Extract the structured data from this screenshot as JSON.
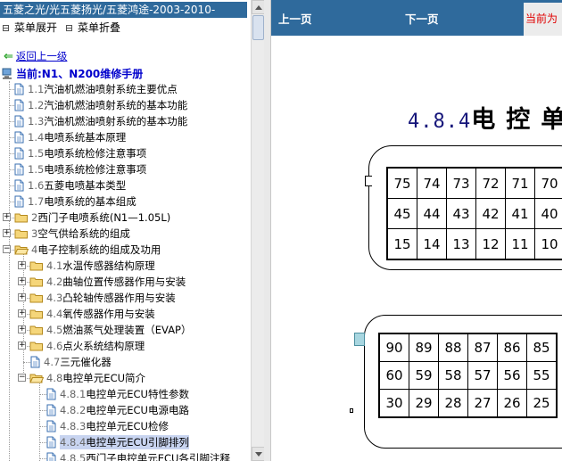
{
  "window": {
    "title": "五菱之光/光五菱扬光/五菱鸿途-2003-2010-"
  },
  "menu": {
    "expand_label": "菜单展开",
    "collapse_label": "菜单折叠"
  },
  "nav": {
    "back_label": "返回上一级",
    "current_label": "当前:N1、N200维修手册"
  },
  "tree": [
    {
      "num": "1.1",
      "label": "汽油机燃油喷射系统主要优点",
      "type": "doc"
    },
    {
      "num": "1.2",
      "label": "汽油机燃油喷射系统的基本功能",
      "type": "doc"
    },
    {
      "num": "1.3",
      "label": "汽油机燃油喷射系统的基本功能",
      "type": "doc"
    },
    {
      "num": "1.4",
      "label": "电喷系统基本原理",
      "type": "doc"
    },
    {
      "num": "1.5",
      "label": "电喷系统检修注意事项",
      "type": "doc"
    },
    {
      "num": "1.5",
      "label": "电喷系统检修注意事项",
      "type": "doc"
    },
    {
      "num": "1.6",
      "label": "五菱电喷基本类型",
      "type": "doc"
    },
    {
      "num": "1.7",
      "label": "电喷系统的基本组成",
      "type": "doc"
    },
    {
      "num": "2",
      "label": "西门子电喷系统(N1—1.05L)",
      "type": "folder"
    },
    {
      "num": "3",
      "label": "空气供给系统的组成",
      "type": "folder"
    },
    {
      "num": "4",
      "label": "电子控制系统的组成及功用",
      "type": "folder-open"
    },
    {
      "num": "4.1",
      "label": "水温传感器结构原理",
      "type": "subfolder"
    },
    {
      "num": "4.2",
      "label": "曲轴位置传感器作用与安装",
      "type": "subfolder"
    },
    {
      "num": "4.3",
      "label": "凸轮轴传感器作用与安装",
      "type": "subfolder"
    },
    {
      "num": "4.4",
      "label": "氧传感器作用与安装",
      "type": "subfolder"
    },
    {
      "num": "4.5",
      "label": "燃油蒸气处理装置（EVAP）",
      "type": "subfolder"
    },
    {
      "num": "4.6",
      "label": "点火系统结构原理",
      "type": "subfolder"
    },
    {
      "num": "4.7",
      "label": "三元催化器",
      "type": "subdoc"
    },
    {
      "num": "4.8",
      "label": "电控单元ECU简介",
      "type": "subfolder-open"
    },
    {
      "num": "4.8.1",
      "label": "电控单元ECU特性参数",
      "type": "leaf"
    },
    {
      "num": "4.8.2",
      "label": "电控单元ECU电源电路",
      "type": "leaf"
    },
    {
      "num": "4.8.3",
      "label": "电控单元ECU检修",
      "type": "leaf"
    },
    {
      "num": "4.8.4",
      "label": "电控单元ECU引脚排列",
      "type": "leaf",
      "selected": true
    },
    {
      "num": "4.8.5",
      "label": "西门子电控单元ECU各引脚注释",
      "type": "leaf"
    }
  ],
  "toolbar": {
    "prev_label": "上一页",
    "next_label": "下一页",
    "current_label": "当前为"
  },
  "content": {
    "heading_num": "4.8.4",
    "heading_text": "电控单",
    "connector1": [
      [
        "75",
        "74",
        "73",
        "72",
        "71",
        "70"
      ],
      [
        "45",
        "44",
        "43",
        "42",
        "41",
        "40"
      ],
      [
        "15",
        "14",
        "13",
        "12",
        "11",
        "10"
      ]
    ],
    "connector2": [
      [
        "90",
        "89",
        "88",
        "87",
        "86",
        "85"
      ],
      [
        "60",
        "59",
        "58",
        "57",
        "56",
        "55"
      ],
      [
        "30",
        "29",
        "28",
        "27",
        "26",
        "25"
      ]
    ]
  },
  "colors": {
    "header_blue": "#2f6a9c",
    "link_blue": "#0000cc",
    "current_red": "#e00000",
    "selected_bg": "#c8d4f0"
  },
  "icons": {
    "back": "back-arrow-icon",
    "current": "computer-icon",
    "folder": "folder-icon",
    "document": "document-icon",
    "menu": "menu-square-icon"
  }
}
